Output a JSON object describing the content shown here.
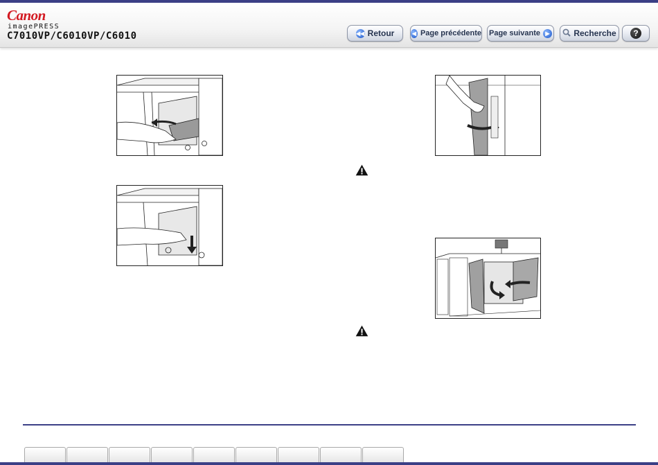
{
  "header": {
    "brand": "Canon",
    "product": "imagePRESS",
    "model": "C7010VP/C6010VP/C6010"
  },
  "nav": {
    "back_label": "Retour",
    "prev_label": "Page précédente",
    "next_label": "Page suivante",
    "search_label": "Recherche",
    "help_icon": "?"
  },
  "icons": {
    "back": "double-arrow-left-icon",
    "prev": "arrow-left-icon",
    "next": "arrow-right-icon",
    "search": "magnifier-icon",
    "help": "question-icon",
    "warning": "warning-icon"
  },
  "colors": {
    "brand_red": "#d31a22",
    "accent_navy": "#3b3f86",
    "button_text": "#26344f",
    "button_icon_blue": "#1d57c8"
  },
  "tabs_count": 9
}
